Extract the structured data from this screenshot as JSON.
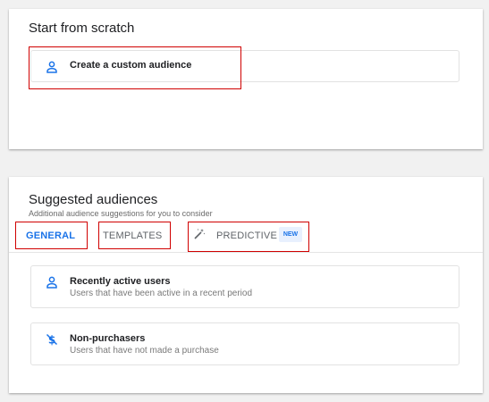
{
  "scratch": {
    "title": "Start from scratch",
    "create_label": "Create a custom audience"
  },
  "suggested": {
    "title": "Suggested audiences",
    "subtitle": "Additional audience suggestions for you to consider",
    "tabs": {
      "general": "GENERAL",
      "templates": "TEMPLATES",
      "predictive": "PREDICTIVE",
      "new_badge": "NEW"
    },
    "audiences": [
      {
        "label": "Recently active users",
        "description": "Users that have been active in a recent period",
        "icon": "person-icon"
      },
      {
        "label": "Non-purchasers",
        "description": "Users that have not made a purchase",
        "icon": "no-money-icon"
      }
    ]
  },
  "colors": {
    "accent": "#1a73e8",
    "highlight": "#d00000"
  }
}
